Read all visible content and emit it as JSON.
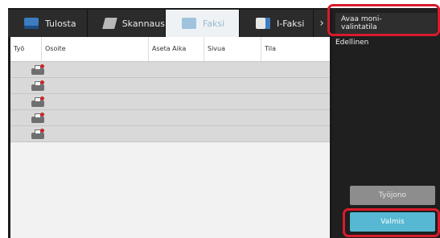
{
  "tabs": [
    {
      "label": "Tulosta",
      "icon": "printer-icon"
    },
    {
      "label": "Skannaus",
      "icon": "scanner-icon"
    },
    {
      "label": "Faksi",
      "icon": "fax-icon",
      "active": true
    },
    {
      "label": "I-Faksi",
      "icon": "ifax-icon"
    }
  ],
  "tab_scroll_icon": "›",
  "table": {
    "columns": [
      "Työ",
      "Osoite",
      "Aseta Aika",
      "Sivua",
      "Tila"
    ],
    "rows": [
      {
        "status_icon": "fax-job-icon"
      },
      {
        "status_icon": "fax-job-icon"
      },
      {
        "status_icon": "fax-job-icon"
      },
      {
        "status_icon": "fax-job-icon"
      },
      {
        "status_icon": "fax-job-icon"
      }
    ]
  },
  "side": {
    "multiselect_label": "Avaa moni-\nvalintatila",
    "previous_label": "Edellinen",
    "job_queue_label": "Työjono",
    "done_label": "Valmis"
  },
  "colors": {
    "highlight": "#d81c2b",
    "done_button": "#56b8d2",
    "active_tab_text": "#9ab8cc"
  }
}
